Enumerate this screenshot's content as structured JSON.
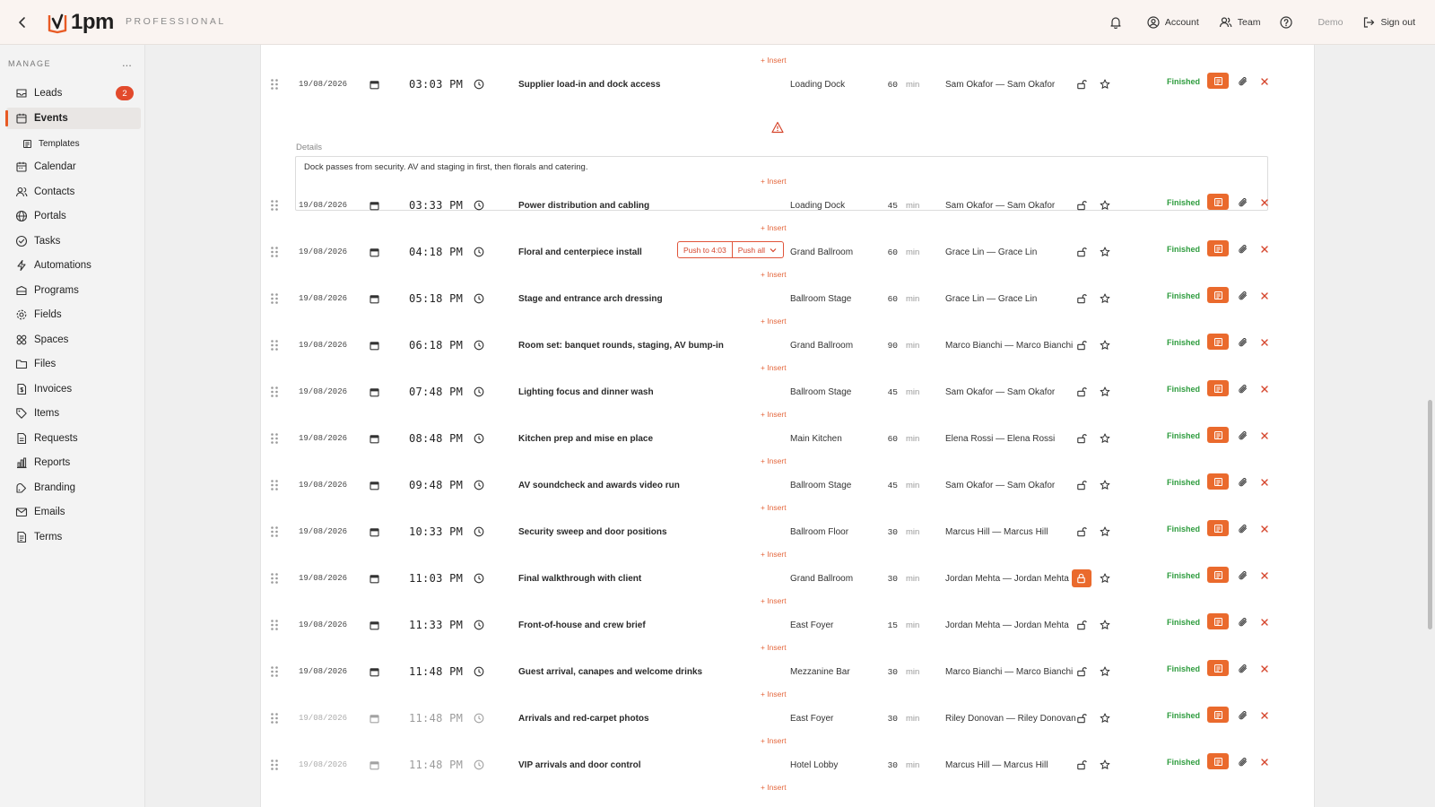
{
  "header": {
    "logo_text": "1pm",
    "plan": "PROFESSIONAL",
    "account": "Account",
    "team": "Team",
    "demo": "Demo",
    "sign_out": "Sign out"
  },
  "sidebar": {
    "section": "MANAGE",
    "more": "...",
    "items": {
      "leads": "Leads",
      "leads_badge": "2",
      "events": "Events",
      "templates": "Templates",
      "calendar": "Calendar",
      "contacts": "Contacts",
      "portals": "Portals",
      "tasks": "Tasks",
      "automations": "Automations",
      "programs": "Programs",
      "fields": "Fields",
      "spaces": "Spaces",
      "files": "Files",
      "invoices": "Invoices",
      "items": "Items",
      "requests": "Requests",
      "reports": "Reports",
      "branding": "Branding",
      "emails": "Emails",
      "terms": "Terms"
    }
  },
  "colors": {
    "accent": "#ea6a2d",
    "finished": "#2e9c3e",
    "insert": "#e4683e",
    "badge": "#e24a2c"
  },
  "labels": {
    "insert": "+ Insert",
    "details": "Details",
    "details_text": "Dock passes from security. AV and staging in first, then florals and catering.",
    "push_to": "Push to 4:03",
    "push_all": "Push all",
    "unit": "min"
  },
  "rows": [
    {
      "date": "19/08/2026",
      "time": "03:03 PM",
      "title": "Supplier load-in and dock access",
      "location": "Loading Dock",
      "duration": "60",
      "assignee": "Sam Okafor — Sam Okafor",
      "status": "Finished"
    },
    {
      "date": "19/08/2026",
      "time": "03:33 PM",
      "title": "Power distribution and cabling",
      "location": "Loading Dock",
      "duration": "45",
      "assignee": "Sam Okafor — Sam Okafor",
      "status": "Finished"
    },
    {
      "date": "19/08/2026",
      "time": "04:18 PM",
      "title": "Floral and centerpiece install",
      "location": "Grand Ballroom",
      "duration": "60",
      "assignee": "Grace Lin — Grace Lin",
      "status": "Finished"
    },
    {
      "date": "19/08/2026",
      "time": "05:18 PM",
      "title": "Stage and entrance arch dressing",
      "location": "Ballroom Stage",
      "duration": "60",
      "assignee": "Grace Lin — Grace Lin",
      "status": "Finished"
    },
    {
      "date": "19/08/2026",
      "time": "06:18 PM",
      "title": "Room set: banquet rounds, staging, AV bump-in",
      "location": "Grand Ballroom",
      "duration": "90",
      "assignee": "Marco Bianchi — Marco Bianchi",
      "status": "Finished"
    },
    {
      "date": "19/08/2026",
      "time": "07:48 PM",
      "title": "Lighting focus and dinner wash",
      "location": "Ballroom Stage",
      "duration": "45",
      "assignee": "Sam Okafor — Sam Okafor",
      "status": "Finished"
    },
    {
      "date": "19/08/2026",
      "time": "08:48 PM",
      "title": "Kitchen prep and mise en place",
      "location": "Main Kitchen",
      "duration": "60",
      "assignee": "Elena Rossi — Elena Rossi",
      "status": "Finished"
    },
    {
      "date": "19/08/2026",
      "time": "09:48 PM",
      "title": "AV soundcheck and awards video run",
      "location": "Ballroom Stage",
      "duration": "45",
      "assignee": "Sam Okafor — Sam Okafor",
      "status": "Finished"
    },
    {
      "date": "19/08/2026",
      "time": "10:33 PM",
      "title": "Security sweep and door positions",
      "location": "Ballroom Floor",
      "duration": "30",
      "assignee": "Marcus Hill — Marcus Hill",
      "status": "Finished"
    },
    {
      "date": "19/08/2026",
      "time": "11:03 PM",
      "title": "Final walkthrough with client",
      "location": "Grand Ballroom",
      "duration": "30",
      "assignee": "Jordan Mehta — Jordan Mehta",
      "status": "Finished"
    },
    {
      "date": "19/08/2026",
      "time": "11:33 PM",
      "title": "Front-of-house and crew brief",
      "location": "East Foyer",
      "duration": "15",
      "assignee": "Jordan Mehta — Jordan Mehta",
      "status": "Finished"
    },
    {
      "date": "19/08/2026",
      "time": "11:48 PM",
      "title": "Guest arrival, canapes and welcome drinks",
      "location": "Mezzanine Bar",
      "duration": "30",
      "assignee": "Marco Bianchi — Marco Bianchi",
      "status": "Finished"
    },
    {
      "date": "19/08/2026",
      "time": "11:48 PM",
      "title": "Arrivals and red-carpet photos",
      "location": "East Foyer",
      "duration": "30",
      "assignee": "Riley Donovan — Riley Donovan",
      "status": "Finished"
    },
    {
      "date": "19/08/2026",
      "time": "11:48 PM",
      "title": "VIP arrivals and door control",
      "location": "Hotel Lobby",
      "duration": "30",
      "assignee": "Marcus Hill — Marcus Hill",
      "status": "Finished"
    }
  ]
}
